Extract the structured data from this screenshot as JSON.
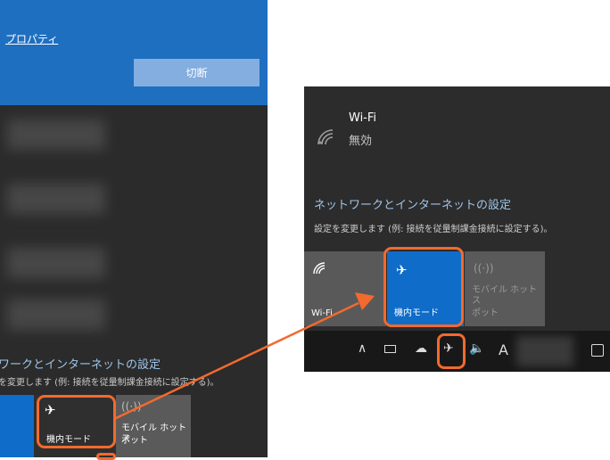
{
  "left_panel": {
    "properties_link": "プロパティ",
    "disconnect_button": "切断",
    "heading": "ワークとインターネットの設定",
    "subtext": "を変更します (例: 接続を従量制課金接続に設定する)。",
    "tile_airplane": "機内モード",
    "tile_hotspot_line1": "モバイル ホットス",
    "tile_hotspot_line2": "ポット"
  },
  "right_panel": {
    "wifi_title": "Wi-Fi",
    "wifi_status": "無効",
    "heading": "ネットワークとインターネットの設定",
    "subtext": "設定を変更します (例: 接続を従量制課金接続に設定する)。",
    "tile_wifi": "Wi-Fi",
    "tile_airplane": "機内モード",
    "tile_hotspot_line1": "モバイル ホットス",
    "tile_hotspot_line2": "ポット",
    "taskbar_chevron": "∧",
    "taskbar_ime": "A"
  },
  "icons": {
    "airplane": "airplane-icon",
    "wifi": "wifi-icon",
    "hotspot": "hotspot-icon",
    "battery": "battery-icon",
    "cloud": "onedrive-cloud-icon",
    "volume": "volume-icon",
    "notification": "notification-icon"
  },
  "colors": {
    "accent_blue": "#0f6cc9",
    "highlight_orange": "#f26a2e",
    "panel_dark": "#2c2c2c",
    "link_blue": "#9fc5ea"
  }
}
